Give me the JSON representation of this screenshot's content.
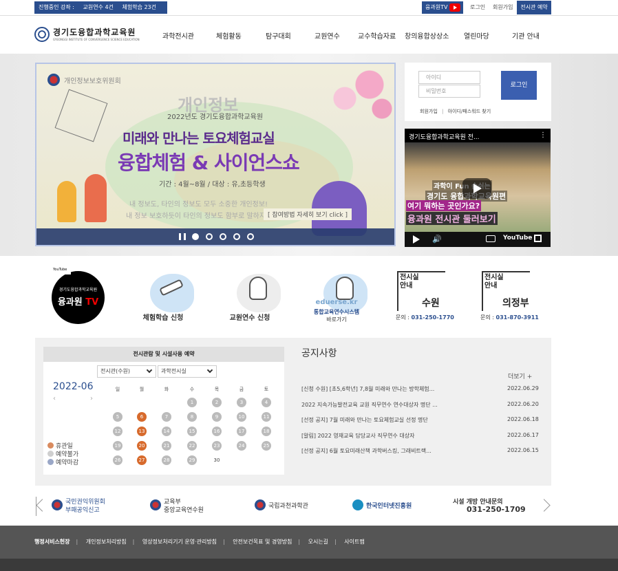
{
  "topbar": {
    "status_label": "진행중인 강좌 :",
    "teacher_course": "교원연수 4건",
    "experience_course": "체험학습 23건",
    "tv_label": "융과원TV",
    "login_link": "로그인",
    "join_link": "회원가입",
    "reserve_button": "전시관 예약"
  },
  "header": {
    "logo_name": "경기도융합과학교육원",
    "logo_sub": "GYEONGGI INSTITUTE OF CONVERGENCE SCIENCE EDUCATION",
    "menu": [
      "과학전시관",
      "체험활동",
      "탐구대회",
      "교원연수",
      "교수학습자료",
      "창의융합상상소",
      "열린마당",
      "기관 안내"
    ]
  },
  "slider": {
    "agency": "개인정보보호위원회",
    "watermark_title": "개인정보",
    "year_line": "2022년도 경기도융합과학교육원",
    "title1": "미래와 만나는 토요체험교실",
    "title2": "융합체험 & 사이언스쇼",
    "period": "기간 : 4월~8월 / 대상 : 유,초등학생",
    "watermark2": "내 정보도, 타인의 정보도 모두 소중한 개인정보!",
    "watermark3": "내 정보 보호하듯이 타인의 정보도 함부로 말하지 마세요",
    "cta": "[ 참여방법 자세히 보기 click ]",
    "pause_icon": "pause-icon",
    "dots_total": 5,
    "active_dot": 1
  },
  "login": {
    "id_placeholder": "아이디",
    "pw_placeholder": "비밀번호",
    "button": "로그인",
    "join": "회원가입",
    "separator": "|",
    "find": "아이디/패스워드 찾기"
  },
  "video": {
    "title": "경기도융합과학교육원 전...",
    "menu_icon": "⋮",
    "line1": "과학이 Fun 숨쉬는",
    "line2": "경기도 융합과학교육원편",
    "line3": "여기 뭐하는 곳인가요?",
    "line4": "융과원 전시관 둘러보기",
    "volume_icon": "🔊",
    "brand": "YouTube"
  },
  "quick": {
    "tv_badge": "YouTube",
    "tv_top": "경기도융합과학교육원",
    "tv_main": "융과원",
    "tv_suffix": "TV",
    "items": [
      {
        "label": "체험학습 신청"
      },
      {
        "label": "교원연수 신청"
      },
      {
        "label": "통합교육연수시스템",
        "sub": "바로가기",
        "brand": "eduerse.kr"
      }
    ],
    "info": [
      {
        "title_line1": "전시실",
        "title_line2": "안내",
        "city": "수원",
        "tel_prefix": "문의 :",
        "tel": "031-250-1770"
      },
      {
        "title_line1": "전시실",
        "title_line2": "안내",
        "city": "의정부",
        "tel_prefix": "문의 :",
        "tel": "031-870-3911"
      }
    ]
  },
  "calendar": {
    "header": "전시관람 및 시설사용 예약",
    "select1": "전시관(수원)",
    "select2": "과학전시실",
    "month": "2022-06",
    "prev": "‹",
    "next": "›",
    "weekdays": [
      "일",
      "월",
      "화",
      "수",
      "목",
      "금",
      "토"
    ],
    "first_weekday": 3,
    "days_in_month": 30,
    "holidays": [
      6,
      13,
      20,
      27
    ],
    "plain_days": [
      30
    ],
    "legend": [
      "휴관일",
      "예약불가",
      "예약마감"
    ],
    "legend_colors": [
      "#d98b5f",
      "#cfcfcf",
      "#9aa7c7"
    ]
  },
  "notices": {
    "title": "공지사항",
    "more": "더보기 +",
    "items": [
      {
        "text": "[신청 수원] [초5,6학년] 7,8월 미래와 만나는 방학체험...",
        "date": "2022.06.29"
      },
      {
        "text": "2022 지속가능발전교육 교원 직무연수 연수대상자 명단 ...",
        "date": "2022.06.20"
      },
      {
        "text": "[선정 공지] 7월 미래와 만나는 토요체험교실 선정 명단",
        "date": "2022.06.18"
      },
      {
        "text": "[알림] 2022 영재교육 담당교사 직무연수 대상자",
        "date": "2022.06.17"
      },
      {
        "text": "[선정 공지] 6월 토요미래산책 과학버스킹, 그래비트랙...",
        "date": "2022.06.15"
      }
    ]
  },
  "banners": [
    {
      "line1": "국민권익위원회",
      "line2": "부패공익신고"
    },
    {
      "line1": "교육부",
      "line2": "중앙교육연수원"
    },
    {
      "line1": "국립과천과학관",
      "line2": ""
    },
    {
      "line1": "한국인터넷진흥원",
      "line2": ""
    },
    {
      "line1": "시설 개방 안내문의",
      "line2": "031-250-1709"
    }
  ],
  "footer": {
    "links": [
      "행정서비스헌장",
      "개인정보처리방침",
      "영상정보처리기기 운영·관리방침",
      "안전보건목표 및 경영방침",
      "오시는길",
      "사이트맵"
    ],
    "separator": "|"
  }
}
